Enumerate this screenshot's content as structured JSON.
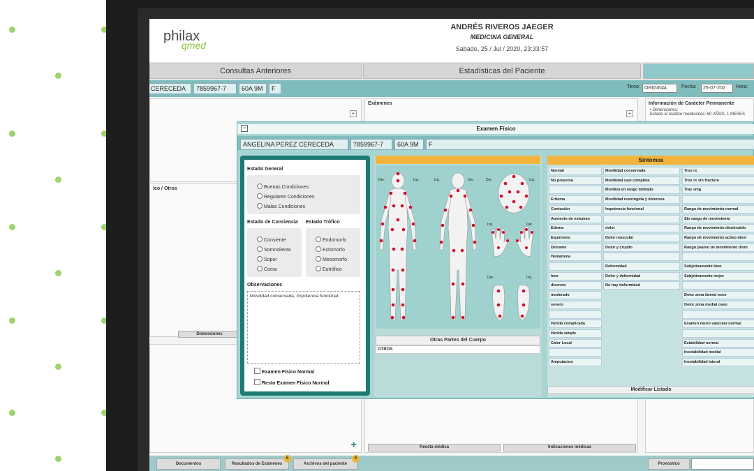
{
  "header": {
    "logo_main": "philax",
    "logo_sub": "qmed",
    "doctor_name": "ANDRÉS RIVEROS JAEGER",
    "specialty": "MEDICINA GENERAL",
    "datetime": "Sabado, 25 / Jul / 2020, 23:33:57"
  },
  "tabs": [
    {
      "label": "Consultas Anteriores"
    },
    {
      "label": "Estadísticas del Paciente"
    },
    {
      "label": ""
    }
  ],
  "patient_strip": {
    "name": "CERECEDA",
    "id": "7859967-7",
    "age": "60A 9M",
    "sex": "F",
    "texto_label": "Texto:",
    "texto_value": "ORIGINAL",
    "fecha_label": "Fecha:",
    "fecha_value": "25-07-202",
    "hora_label": "Hora:"
  },
  "background_panels": {
    "examenes_title": "Exámenes",
    "info_title": "Información de Carácter Permanente",
    "info_item_1": "• Dimensiones:",
    "info_item_2": "Estado al realizar mediciones: 60 AÑOS, 1 MESES",
    "left_section": "ico / Otros",
    "dimensiones_tab": "Dimensiones",
    "receta": "Receta médica",
    "indicaciones": "Indicaciones médicas",
    "pronostico": "Pronóstico"
  },
  "bottom_buttons": [
    {
      "label": "Documentos",
      "badge": ""
    },
    {
      "label": "Resultados de Exámenes",
      "badge": "6"
    },
    {
      "label": "Archivos del paciente",
      "badge": "6"
    }
  ],
  "modal": {
    "title": "Examen Físico",
    "patient_name": "ANGELINA PEREZ CERECEDA",
    "patient_id": "7859967-7",
    "patient_age": "60A 9M",
    "patient_sex": "F",
    "estado_general": "Estado General",
    "general_options": [
      "Buenas Condiciones",
      "Regulares Condiciones",
      "Malas Condiciones"
    ],
    "conciencia_title": "Estado de Conciencia",
    "conciencia_options": [
      "Consiente",
      "Somnoliento",
      "Sopor",
      "Coma"
    ],
    "trofico_title": "Estado Trófico",
    "trofico_options": [
      "Endomorfo",
      "Ectomorfo",
      "Mesomorfo",
      "Eutrófico"
    ],
    "observaciones_title": "Observaciones",
    "observaciones_text": "Movilidad conservada, Impotencia funcional.",
    "check_normal": "Examen Físico Normal",
    "check_resto": "Resto Examen Físico Normal",
    "body_labels": {
      "der": "Der.",
      "izq": "Izq."
    },
    "otras_title": "Otras Partes del Cuerpo",
    "otros": "OTROS",
    "sintomas_title": "Síntomas",
    "sintomas_col1": [
      "Normal",
      "No presenta",
      "",
      "Eritema",
      "Contusión",
      "Aumento de volumen",
      "Edema",
      "Equimosis",
      "Derrame",
      "Hematoma",
      "",
      "leve",
      "discreto",
      "moderado",
      "severo",
      "",
      "Herida complicada",
      "Herida simple",
      "Calor Local",
      "",
      "Amputacion"
    ],
    "sintomas_col2": [
      "Movilidad conservada",
      "Movilidad casi completa",
      "Moviliza en rango limitado",
      "Movilidad restringida y dolorosa",
      "Impotencia funcional",
      "",
      "dolor",
      "Dolor muscular",
      "Dolor y crujido",
      "",
      "Deformidad",
      "Dolor y deformidad",
      "No hay deformidad"
    ],
    "sintomas_col3": [
      "Trox rx",
      "Trox rx sin fractura",
      "Trax smg",
      "",
      "Rango de movimiento normal",
      "Sin rango de movimiento",
      "Rango de movimiento disminuido",
      "Rango de movimiento activo dism",
      "Rango pasivo de movimiento dism",
      "",
      "Subjetivamente bien",
      "Subjetivamente mejor",
      "",
      "Dolor zona lateral oseo",
      "Dolor zona medial oseo",
      "",
      "Examen neuro vascular normal",
      "",
      "Estabilidad normal",
      "Inestabilidad medial",
      "Inestabilidad lateral"
    ],
    "modificar": "Modificar Listado"
  },
  "colors": {
    "teal_dark": "#1c7a73",
    "teal_strip": "#7fbdbd",
    "orange": "#f2b43d",
    "marker_red": "#d0102a",
    "logo_green": "#88c23f"
  }
}
